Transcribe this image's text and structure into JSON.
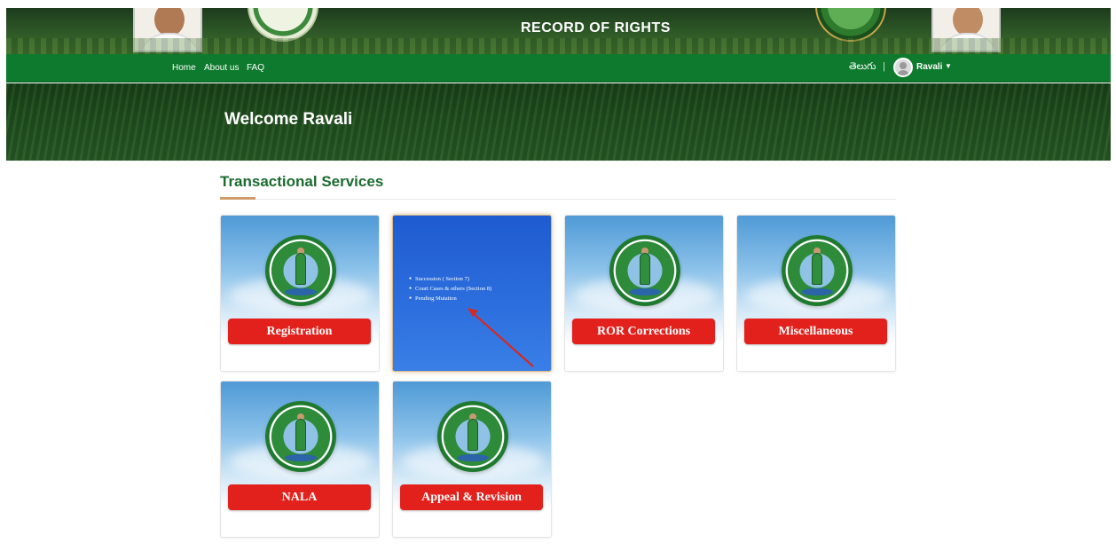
{
  "header": {
    "banner_title": "RECORD OF RIGHTS"
  },
  "nav": {
    "links": [
      "Home",
      "About us",
      "FAQ"
    ],
    "language": "తెలుగు",
    "separator": "|",
    "user_name": "Ravali"
  },
  "hero": {
    "welcome": "Welcome Ravali"
  },
  "services": {
    "title": "Transactional Services",
    "cards": [
      {
        "label": "Registration"
      },
      {
        "submenu": [
          "Succession ( Section 7)",
          "Court Cases & others (Section 8)",
          "Pending Mutation"
        ]
      },
      {
        "label": "ROR Corrections"
      },
      {
        "label": "Miscellaneous"
      },
      {
        "label": "NALA"
      },
      {
        "label": "Appeal & Revision"
      }
    ]
  },
  "colors": {
    "navbar": "#0d7a2d",
    "title_green": "#1b6b2e",
    "button_red": "#e2211c",
    "active_card_blue": "#1e5bd1",
    "arrow_red": "#d42a24"
  }
}
